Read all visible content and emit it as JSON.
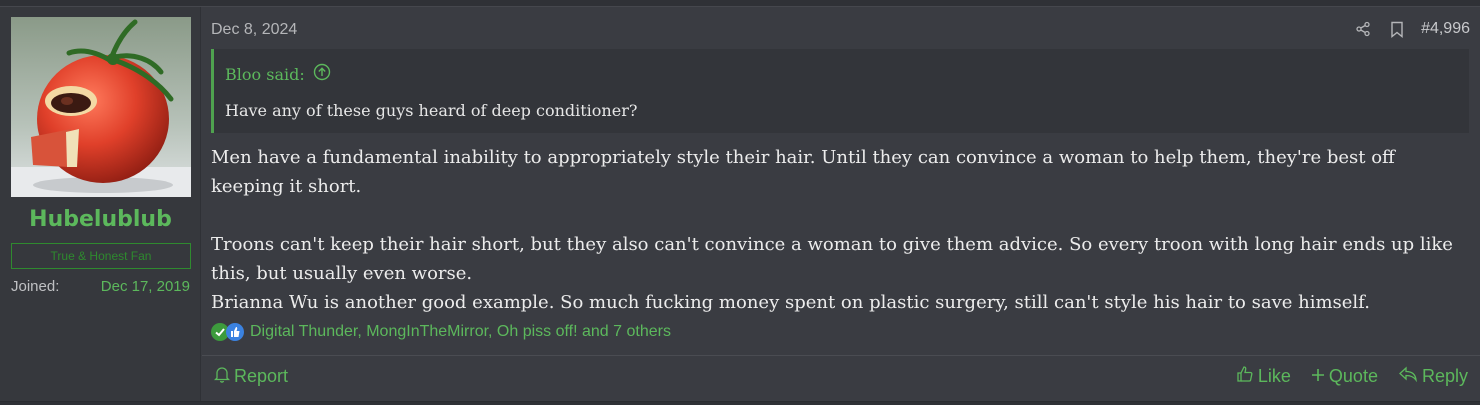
{
  "user": {
    "name": "Hubelublub",
    "title": "True & Honest Fan",
    "joined_label": "Joined:",
    "joined_value": "Dec 17, 2019"
  },
  "post": {
    "date": "Dec 8, 2024",
    "number": "#4,996",
    "quote": {
      "author_label": "Bloo said:",
      "text": "Have any of these guys heard of deep conditioner?"
    },
    "body": {
      "p1": "Men have a fundamental inability to appropriately style their hair. Until they can convince a woman to help them, they're best off keeping it short.",
      "p2": "Troons can't keep their hair short, but they also can't convince a woman to give them advice. So every troon with long hair ends up like this, but usually even worse.",
      "p3": "Brianna Wu is another good example. So much fucking money spent on plastic surgery, still can't style his hair to save himself."
    },
    "reactions": {
      "icons": [
        "check-reaction-icon",
        "like-reaction-icon"
      ],
      "text": "Digital Thunder, MongInTheMirror, Oh piss off! and 7 others"
    }
  },
  "actions": {
    "report": "Report",
    "like": "Like",
    "quote": "Quote",
    "reply": "Reply"
  },
  "colors": {
    "accent": "#5cb85c",
    "background": "#3a3c42",
    "sidebar": "#36383d",
    "quote_bg": "#33353a"
  }
}
